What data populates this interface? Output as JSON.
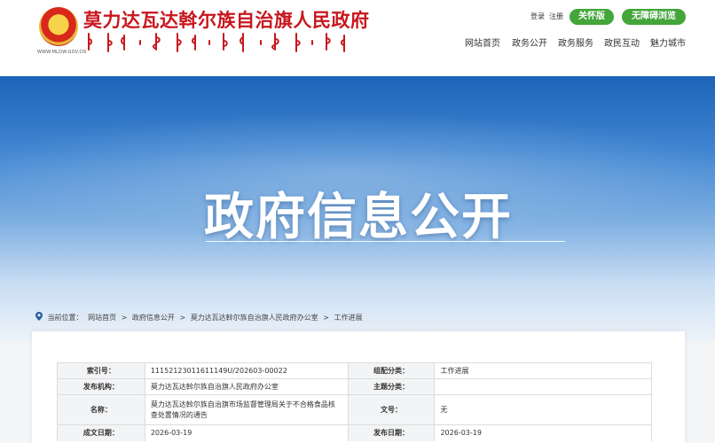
{
  "header": {
    "site_title": "莫力达瓦达斡尔族自治旗人民政府",
    "emblem_caption": "WWW.MLDW.GOV.CN",
    "login": "登录",
    "register": "注册",
    "care_mode": "关怀版",
    "accessible": "无障碍浏览",
    "nav": [
      "网站首页",
      "政务公开",
      "政务服务",
      "政民互动",
      "魅力城市"
    ]
  },
  "banner": {
    "title": "政府信息公开"
  },
  "breadcrumb": {
    "prefix": "当前位置：",
    "items": [
      "网站首页",
      ">",
      "政府信息公开",
      ">",
      "莫力达瓦达斡尔族自治旗人民政府办公室",
      ">",
      "工作进展"
    ]
  },
  "meta": {
    "index_label": "索引号：",
    "index_value": "11152123011611149U/202603-00022",
    "category_label": "组配分类：",
    "category_value": "工作进展",
    "org_label": "发布机构：",
    "org_value": "莫力达瓦达斡尔族自治旗人民政府办公室",
    "topic_label": "主题分类：",
    "topic_value": "",
    "name_label": "名称：",
    "name_value": "莫力达瓦达斡尔族自治旗市场监督管理局关于不合格食品核查处置情况的通告",
    "docno_label": "文号：",
    "docno_value": "无",
    "created_label": "成文日期：",
    "created_value": "2026-03-19",
    "published_label": "发布日期：",
    "published_value": "2026-03-19"
  },
  "colors": {
    "brand_red": "#c8161d",
    "button_green": "#43a53a",
    "banner_blue": "#1d63b8"
  }
}
